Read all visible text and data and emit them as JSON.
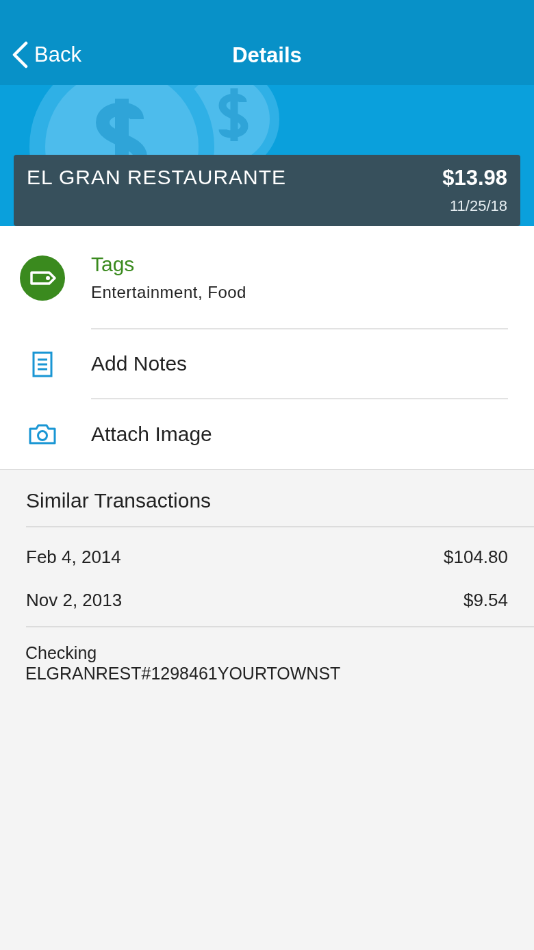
{
  "nav": {
    "back": "Back",
    "title": "Details"
  },
  "transaction": {
    "merchant": "EL GRAN RESTAURANTE",
    "amount": "$13.98",
    "date": "11/25/18"
  },
  "actions": [
    {
      "kind": "tags",
      "label": "Tags",
      "detail": "Entertainment, Food"
    },
    {
      "kind": "notes",
      "label": "Add Notes"
    },
    {
      "kind": "image",
      "label": "Attach Image"
    }
  ],
  "similar": {
    "title": "Similar Transactions",
    "rows": [
      {
        "date": "Feb 4, 2014",
        "amount": "$104.80"
      },
      {
        "date": "Nov 2, 2013",
        "amount": "$9.54"
      }
    ]
  },
  "account": {
    "name": "Checking",
    "description": "ELGRANREST#1298461YOURTOWNST"
  }
}
